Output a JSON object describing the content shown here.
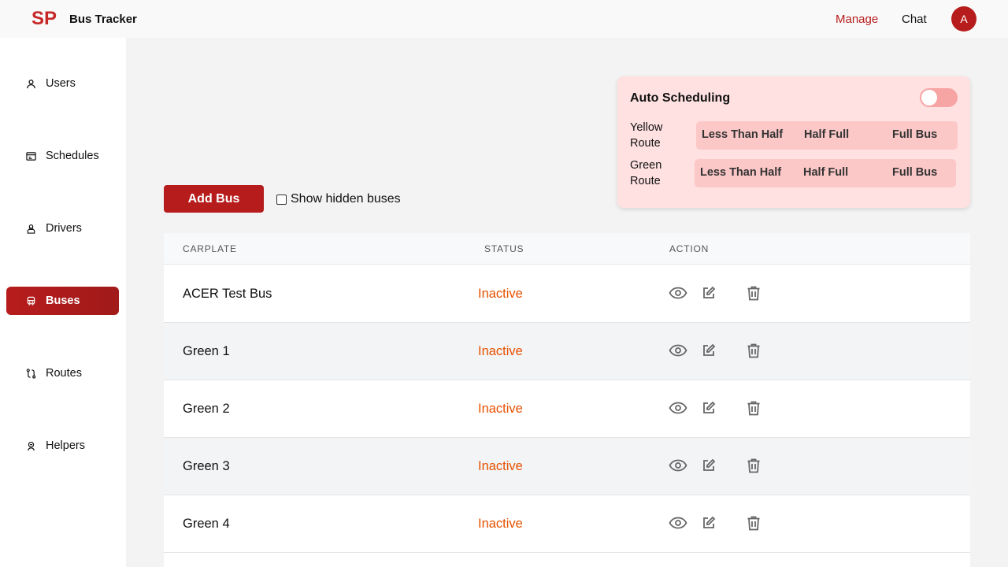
{
  "header": {
    "logo": "SP",
    "title": "Bus Tracker",
    "nav": {
      "manage": "Manage",
      "chat": "Chat"
    },
    "avatar_initial": "A",
    "accent_color": "#b71c1c"
  },
  "sidebar": {
    "items": [
      {
        "label": "Users",
        "icon": "user-icon",
        "active": false
      },
      {
        "label": "Schedules",
        "icon": "calendar-icon",
        "active": false
      },
      {
        "label": "Drivers",
        "icon": "driver-icon",
        "active": false
      },
      {
        "label": "Buses",
        "icon": "bus-icon",
        "active": true
      },
      {
        "label": "Routes",
        "icon": "route-icon",
        "active": false
      },
      {
        "label": "Helpers",
        "icon": "helper-icon",
        "active": false
      }
    ]
  },
  "toolbar": {
    "add_bus_label": "Add Bus",
    "show_hidden_label": "Show hidden buses",
    "show_hidden_checked": false
  },
  "auto_scheduling": {
    "title": "Auto Scheduling",
    "enabled": false,
    "routes": [
      {
        "label": "Yellow Route",
        "options": [
          "Less Than Half",
          "Half Full",
          "Full Bus"
        ]
      },
      {
        "label": "Green Route",
        "options": [
          "Less Than Half",
          "Half Full",
          "Full Bus"
        ]
      }
    ]
  },
  "table": {
    "columns": [
      "CARPLATE",
      "STATUS",
      "ACTION"
    ],
    "rows": [
      {
        "carplate": "ACER Test Bus",
        "status": "Inactive"
      },
      {
        "carplate": "Green 1",
        "status": "Inactive"
      },
      {
        "carplate": "Green 2",
        "status": "Inactive"
      },
      {
        "carplate": "Green 3",
        "status": "Inactive"
      },
      {
        "carplate": "Green 4",
        "status": "Inactive"
      }
    ],
    "actions": [
      "view-icon",
      "edit-icon",
      "delete-icon"
    ],
    "status_color": "#e65100"
  }
}
